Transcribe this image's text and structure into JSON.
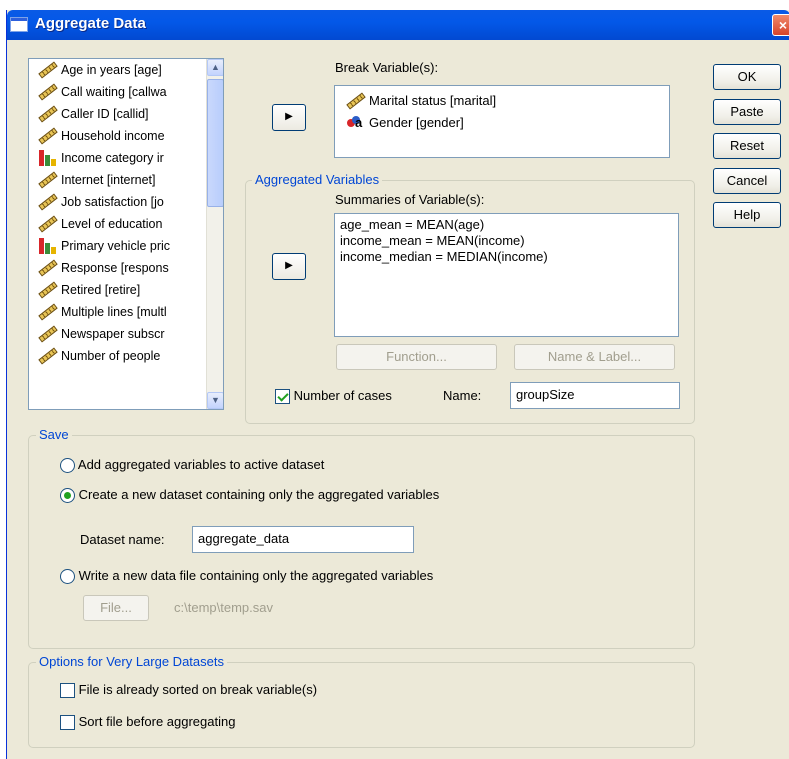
{
  "window": {
    "title": "Aggregate Data",
    "close_label": "×"
  },
  "source_list": {
    "items": [
      {
        "label": "Age in years [age]",
        "icon": "scale-icon"
      },
      {
        "label": "Call waiting [callwa",
        "icon": "scale-icon"
      },
      {
        "label": "Caller ID [callid]",
        "icon": "scale-icon"
      },
      {
        "label": "Household income",
        "icon": "scale-icon"
      },
      {
        "label": "Income category ir",
        "icon": "ordinal-bar-icon"
      },
      {
        "label": "Internet [internet]",
        "icon": "scale-icon"
      },
      {
        "label": "Job satisfaction [jo",
        "icon": "scale-icon"
      },
      {
        "label": "Level of education",
        "icon": "scale-icon"
      },
      {
        "label": "Primary vehicle pric",
        "icon": "ordinal-bar-icon"
      },
      {
        "label": "Response [respons",
        "icon": "scale-icon"
      },
      {
        "label": "Retired [retire]",
        "icon": "scale-icon"
      },
      {
        "label": "Multiple lines [multl",
        "icon": "scale-icon"
      },
      {
        "label": "Newspaper subscr",
        "icon": "scale-icon"
      },
      {
        "label": "Number of people",
        "icon": "scale-icon"
      }
    ]
  },
  "break": {
    "label": "Break Variable(s):",
    "items": [
      {
        "label": "Marital status [marital]",
        "icon": "scale-icon"
      },
      {
        "label": "Gender [gender]",
        "icon": "nominal-string-icon"
      }
    ]
  },
  "aggregated": {
    "group_title": "Aggregated Variables",
    "summaries_label": "Summaries of Variable(s):",
    "items": [
      "age_mean = MEAN(age)",
      "income_mean = MEAN(income)",
      "income_median = MEDIAN(income)"
    ],
    "function_button": "Function...",
    "name_label_button": "Name & Label...",
    "number_of_cases_label": "Number of cases",
    "number_of_cases_checked": true,
    "name_label": "Name:",
    "name_value": "groupSize"
  },
  "buttons": {
    "ok": "OK",
    "paste": "Paste",
    "reset": "Reset",
    "cancel": "Cancel",
    "help": "Help"
  },
  "save": {
    "group_title": "Save",
    "add_option": "Add aggregated variables to active dataset",
    "create_option": "Create a new dataset containing only the aggregated variables",
    "dataset_name_label": "Dataset name:",
    "dataset_name_value": "aggregate_data",
    "write_option": "Write a new data file containing only the aggregated variables",
    "file_button": "File...",
    "file_path": "c:\\temp\\temp.sav",
    "selected": "create"
  },
  "options": {
    "group_title": "Options for Very Large Datasets",
    "sorted_label": "File is already sorted on break variable(s)",
    "sort_label": "Sort file before aggregating"
  }
}
